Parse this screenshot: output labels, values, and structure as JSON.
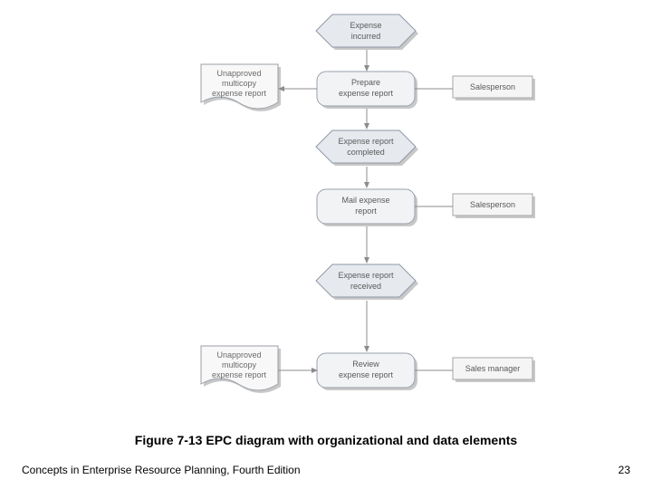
{
  "caption": "Figure 7-13  EPC diagram with organizational and data elements",
  "footer": {
    "left": "Concepts in Enterprise Resource Planning, Fourth Edition",
    "right": "23"
  },
  "nodes": {
    "event1": {
      "line1": "Expense",
      "line2": "incurred"
    },
    "func1": {
      "line1": "Prepare",
      "line2": "expense report"
    },
    "event2": {
      "line1": "Expense report",
      "line2": "completed"
    },
    "func2": {
      "line1": "Mail expense",
      "line2": "report"
    },
    "event3": {
      "line1": "Expense report",
      "line2": "received"
    },
    "func3": {
      "line1": "Review",
      "line2": "expense report"
    }
  },
  "orgs": {
    "o1": "Salesperson",
    "o2": "Salesperson",
    "o3": "Sales manager"
  },
  "docs": {
    "d1": {
      "line1": "Unapproved",
      "line2": "multicopy",
      "line3": "expense report"
    },
    "d2": {
      "line1": "Unapproved",
      "line2": "multicopy",
      "line3": "expense report"
    }
  }
}
